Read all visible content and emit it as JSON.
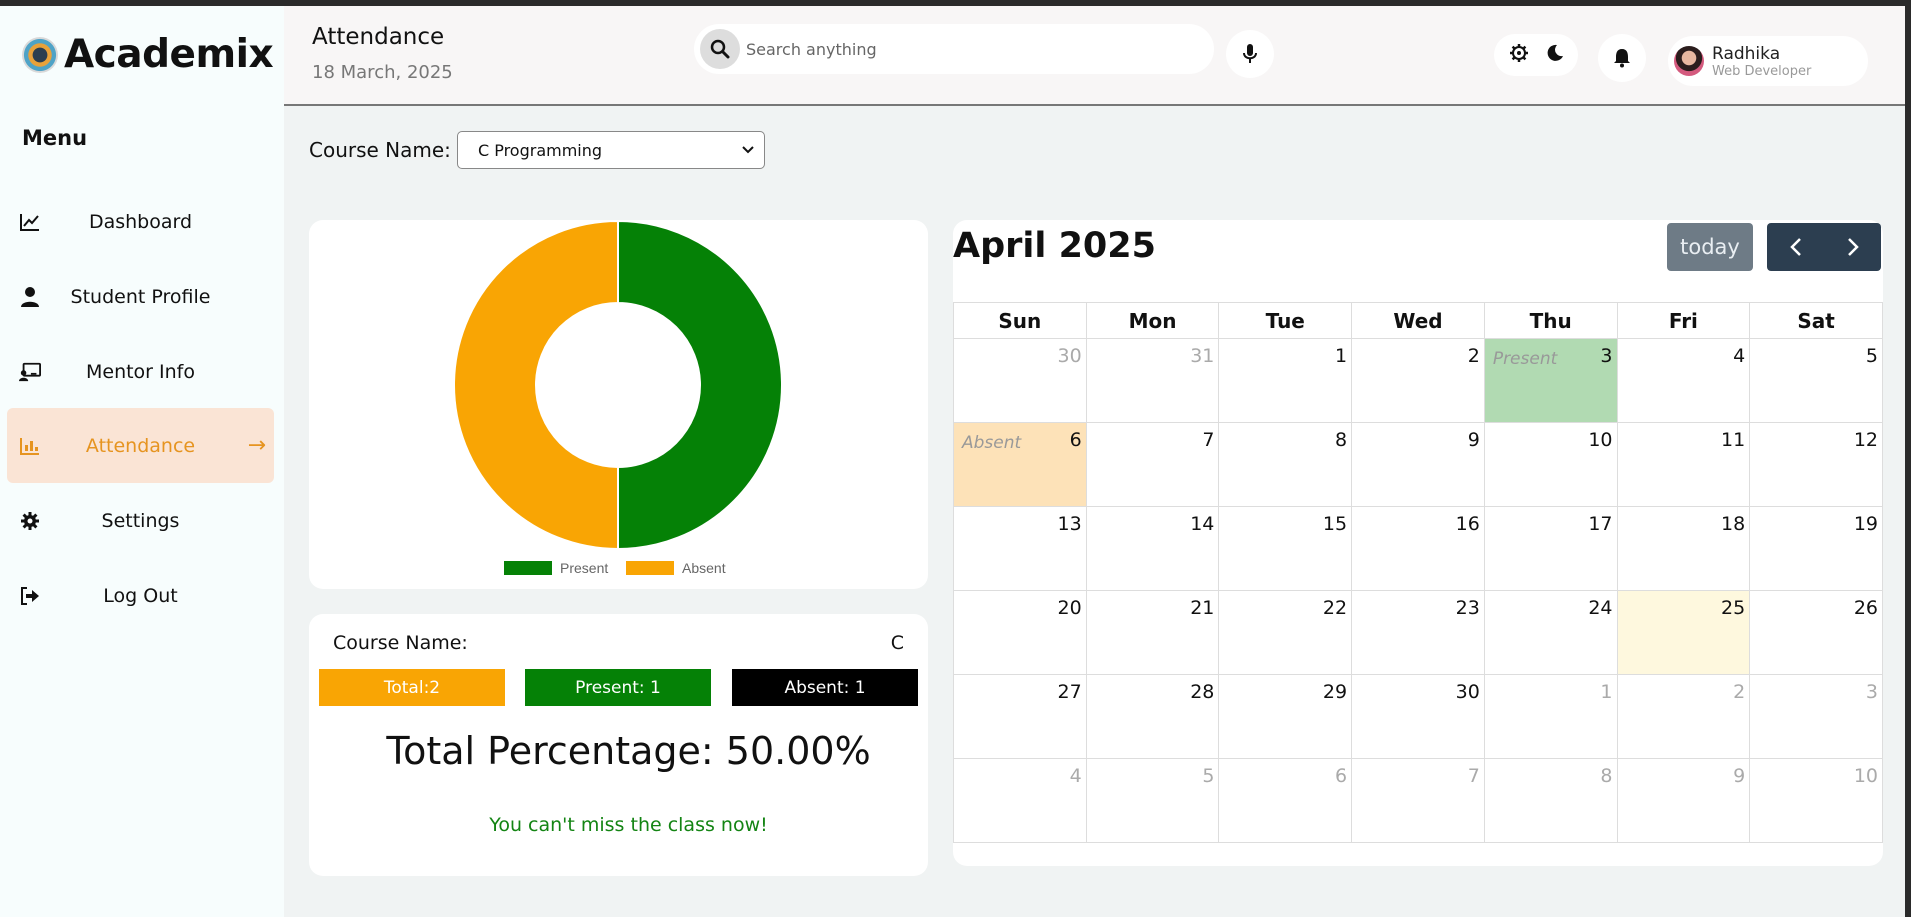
{
  "app": {
    "name": "Academix"
  },
  "sidebar": {
    "menu_title": "Menu",
    "items": [
      {
        "label": "Dashboard",
        "icon": "chart-line-icon"
      },
      {
        "label": "Student Profile",
        "icon": "user-icon"
      },
      {
        "label": "Mentor Info",
        "icon": "teacher-icon"
      },
      {
        "label": "Attendance",
        "icon": "chart-bar-icon",
        "active": true
      },
      {
        "label": "Settings",
        "icon": "gear-icon"
      },
      {
        "label": "Log Out",
        "icon": "logout-icon"
      }
    ]
  },
  "header": {
    "title": "Attendance",
    "date": "18 March, 2025",
    "search_placeholder": "Search anything",
    "user": {
      "name": "Radhika",
      "role": "Web Developer"
    }
  },
  "course_select": {
    "label": "Course Name:",
    "value": "C Programming"
  },
  "chart_data": {
    "type": "pie",
    "variant": "doughnut",
    "labels": [
      "Present",
      "Absent"
    ],
    "values": [
      1,
      1
    ],
    "colors": [
      "#058106",
      "#f9a504"
    ],
    "legend": "bottom"
  },
  "stats": {
    "course_label": "Course Name:",
    "course_value": "C",
    "total": "Total:2",
    "present": "Present: 1",
    "absent": "Absent: 1",
    "percentage": "Total Percentage: 50.00%",
    "message": "You can't miss the class now!"
  },
  "calendar": {
    "title": "April 2025",
    "today_label": "today",
    "weekdays": [
      "Sun",
      "Mon",
      "Tue",
      "Wed",
      "Thu",
      "Fri",
      "Sat"
    ],
    "weeks": [
      [
        {
          "d": "30",
          "o": true
        },
        {
          "d": "31",
          "o": true
        },
        {
          "d": "1"
        },
        {
          "d": "2"
        },
        {
          "d": "3",
          "e": "Present",
          "c": "present"
        },
        {
          "d": "4"
        },
        {
          "d": "5"
        }
      ],
      [
        {
          "d": "6",
          "e": "Absent",
          "c": "absent"
        },
        {
          "d": "7"
        },
        {
          "d": "8"
        },
        {
          "d": "9"
        },
        {
          "d": "10"
        },
        {
          "d": "11"
        },
        {
          "d": "12"
        }
      ],
      [
        {
          "d": "13"
        },
        {
          "d": "14"
        },
        {
          "d": "15"
        },
        {
          "d": "16"
        },
        {
          "d": "17"
        },
        {
          "d": "18"
        },
        {
          "d": "19"
        }
      ],
      [
        {
          "d": "20"
        },
        {
          "d": "21"
        },
        {
          "d": "22"
        },
        {
          "d": "23"
        },
        {
          "d": "24"
        },
        {
          "d": "25",
          "c": "today"
        },
        {
          "d": "26"
        }
      ],
      [
        {
          "d": "27"
        },
        {
          "d": "28"
        },
        {
          "d": "29"
        },
        {
          "d": "30"
        },
        {
          "d": "1",
          "o": true
        },
        {
          "d": "2",
          "o": true
        },
        {
          "d": "3",
          "o": true
        }
      ],
      [
        {
          "d": "4",
          "o": true
        },
        {
          "d": "5",
          "o": true
        },
        {
          "d": "6",
          "o": true
        },
        {
          "d": "7",
          "o": true
        },
        {
          "d": "8",
          "o": true
        },
        {
          "d": "9",
          "o": true
        },
        {
          "d": "10",
          "o": true
        }
      ]
    ]
  }
}
